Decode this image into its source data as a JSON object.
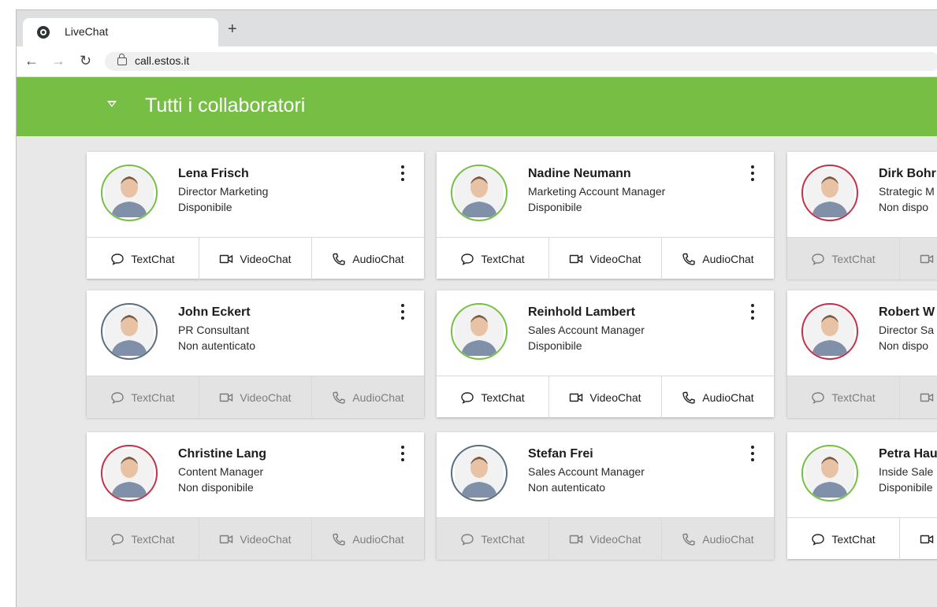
{
  "browser": {
    "tab_title": "LiveChat",
    "new_tab_symbol": "+",
    "url": "call.estos.it"
  },
  "header": {
    "title": "Tutti i collaboratori"
  },
  "labels": {
    "textchat": "TextChat",
    "videochat": "VideoChat",
    "audiochat": "AudioChat"
  },
  "colors": {
    "header_green": "#76bf44",
    "available": "#76bf44",
    "not_available": "#c0334a",
    "not_authenticated": "#5a6e7e"
  },
  "contacts": [
    {
      "name": "Lena Frisch",
      "role": "Director Marketing",
      "status": "Disponibile",
      "state": "available"
    },
    {
      "name": "Nadine Neumann",
      "role": "Marketing Account Manager",
      "status": "Disponibile",
      "state": "available"
    },
    {
      "name": "Dirk Bohr",
      "role": "Strategic M",
      "status": "Non dispo",
      "state": "not-available"
    },
    {
      "name": "John Eckert",
      "role": "PR Consultant",
      "status": "Non autenticato",
      "state": "not-authenticated"
    },
    {
      "name": "Reinhold Lambert",
      "role": "Sales Account Manager",
      "status": "Disponibile",
      "state": "available"
    },
    {
      "name": "Robert W",
      "role": "Director Sa",
      "status": "Non dispo",
      "state": "not-available"
    },
    {
      "name": "Christine Lang",
      "role": "Content Manager",
      "status": "Non disponibile",
      "state": "not-available"
    },
    {
      "name": "Stefan Frei",
      "role": "Sales Account Manager",
      "status": "Non autenticato",
      "state": "not-authenticated"
    },
    {
      "name": "Petra Hau",
      "role": "Inside Sale",
      "status": "Disponibile",
      "state": "available"
    }
  ]
}
